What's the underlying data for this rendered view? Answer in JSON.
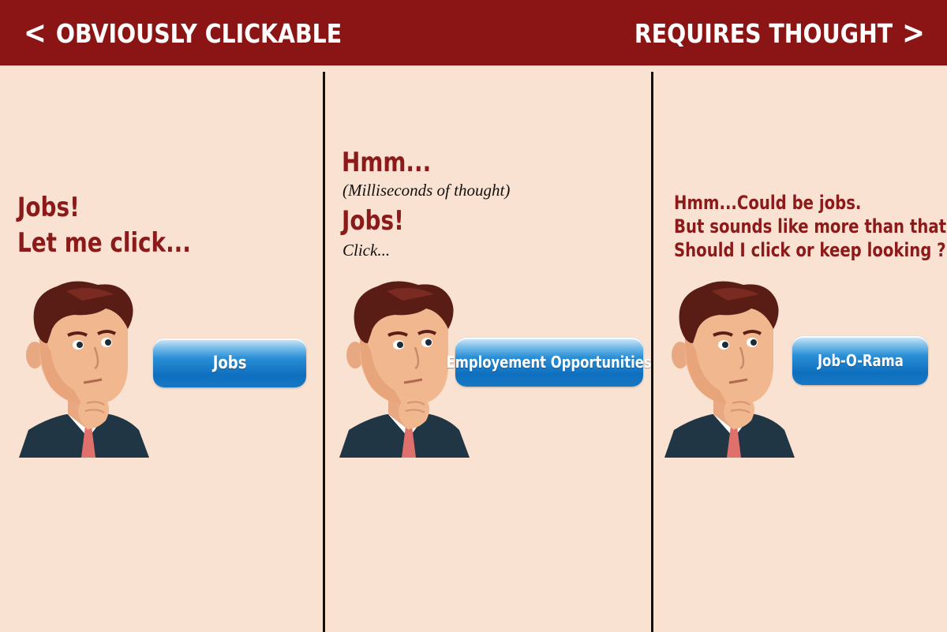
{
  "header": {
    "left_label": "OBVIOUSLY CLICKABLE",
    "right_label": "REQUIRES THOUGHT",
    "left_icon": "chevron-left-icon",
    "right_icon": "chevron-right-icon",
    "background": "#8b1515"
  },
  "panels": [
    {
      "line1": "Jobs!",
      "line2": "Let me click...",
      "button_label": "Jobs"
    },
    {
      "hmm": "Hmm...",
      "thought": "(Milliseconds of thought)",
      "jobs": "Jobs!",
      "click": "Click...",
      "button_label": "Employement Opportunities"
    },
    {
      "line1": "Hmm...Could be jobs.",
      "line2": "But sounds like more than that",
      "line3": "Should I click or keep looking ?",
      "button_label": "Job-O-Rama"
    }
  ],
  "colors": {
    "panel_bg": "#f9e2d2",
    "text_red": "#8b1a1a",
    "button_blue": "#1678c4"
  }
}
